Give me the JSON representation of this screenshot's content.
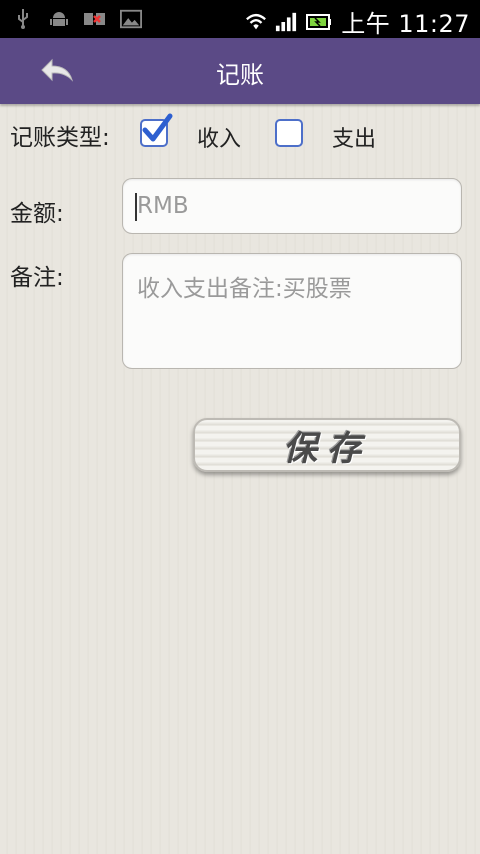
{
  "status_bar": {
    "icons_left": [
      "usb-icon",
      "android-debug-icon",
      "sim-alert-icon",
      "image-notification-icon"
    ],
    "icons_right": [
      "wifi-icon",
      "signal-icon",
      "battery-icon"
    ],
    "time": "上午 11:27"
  },
  "header": {
    "title": "记账",
    "back_icon": "back-arrow-icon"
  },
  "form": {
    "type_label": "记账类型:",
    "income_label": "收入",
    "income_checked": true,
    "expense_label": "支出",
    "expense_checked": false,
    "amount_label": "金额:",
    "amount_placeholder": "RMB",
    "note_label": "备注:",
    "note_placeholder": "收入支出备注:买股票",
    "save_label": "保存"
  },
  "colors": {
    "header_bg": "#5b4a86",
    "checkbox_border": "#4d6fc9",
    "status_bar_bg": "#000000"
  }
}
